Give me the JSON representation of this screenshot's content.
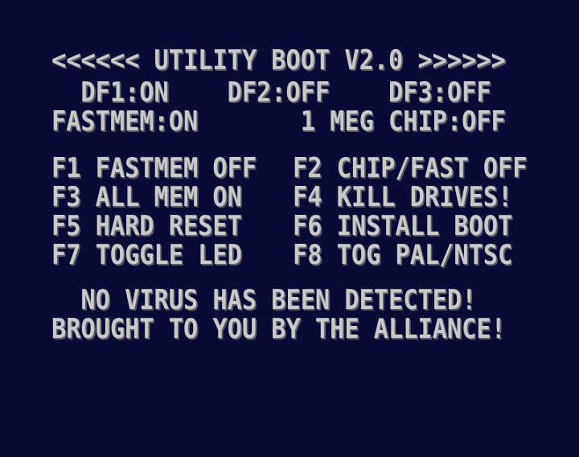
{
  "title": "<<<<<< UTILITY BOOT V2.0 >>>>>>",
  "status": {
    "drives": "  DF1:ON    DF2:OFF    DF3:OFF",
    "memory": "FASTMEM:ON       1 MEG CHIP:OFF"
  },
  "menu": [
    {
      "left": "F1 FASTMEM OFF",
      "right": "F2 CHIP/FAST OFF"
    },
    {
      "left": "F3 ALL MEM ON",
      "right": "F4 KILL DRIVES!"
    },
    {
      "left": "F5 HARD RESET",
      "right": "F6 INSTALL BOOT"
    },
    {
      "left": "F7 TOGGLE LED",
      "right": "F8 TOG PAL/NTSC"
    }
  ],
  "messages": {
    "virus": "  NO VIRUS HAS BEEN DETECTED!",
    "credits": "BROUGHT TO YOU BY THE ALLIANCE!"
  }
}
